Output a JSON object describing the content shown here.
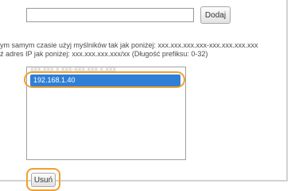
{
  "address_input": {
    "value": "",
    "placeholder": ""
  },
  "add_button": {
    "label": "Dodaj"
  },
  "help_text": {
    "line1": "ym samym czasie użyj myślników tak jak poniżej: xxx.xxx.xxx.xxx-xxx.xxx.xxx.xxx",
    "line2": "ź adres IP jak poniżej: xxx.xxx.xxx.xxx/xx (Długość prefiksu: 0-32)"
  },
  "address_list": {
    "items": [
      {
        "label": "xxx.xxx.x.xxx-xxx.xxx.x.xxx",
        "selected": false
      },
      {
        "label": "192.168.1.40",
        "selected": true
      }
    ]
  },
  "delete_button": {
    "label": "Usuń"
  },
  "colors": {
    "highlight": "#f0a030",
    "selection": "#2f7fd6"
  }
}
